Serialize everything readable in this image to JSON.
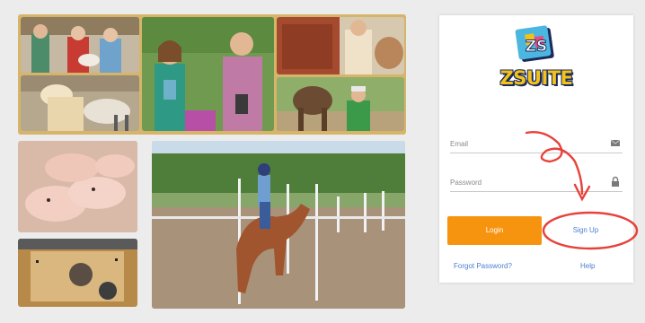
{
  "brand": {
    "logo_letters": "ZS",
    "name": "ZSUITE"
  },
  "login": {
    "email_placeholder": "Email",
    "password_placeholder": "Password",
    "login_label": "Login",
    "signup_label": "Sign Up",
    "forgot_label": "Forgot Password?",
    "help_label": "Help"
  },
  "colors": {
    "accent": "#f7940f",
    "link": "#4a7fd0",
    "annotation": "#e8413a",
    "frame": "#d6b46a"
  },
  "photos": [
    {
      "name": "kids-with-rabbits-photo"
    },
    {
      "name": "teens-with-ribbons-photo"
    },
    {
      "name": "girl-with-cow-photo"
    },
    {
      "name": "woman-with-sheep-photo"
    },
    {
      "name": "boy-with-horse-photo"
    },
    {
      "name": "piglets-photo"
    },
    {
      "name": "barrel-racing-horse-photo"
    },
    {
      "name": "workbench-craft-photo"
    }
  ]
}
